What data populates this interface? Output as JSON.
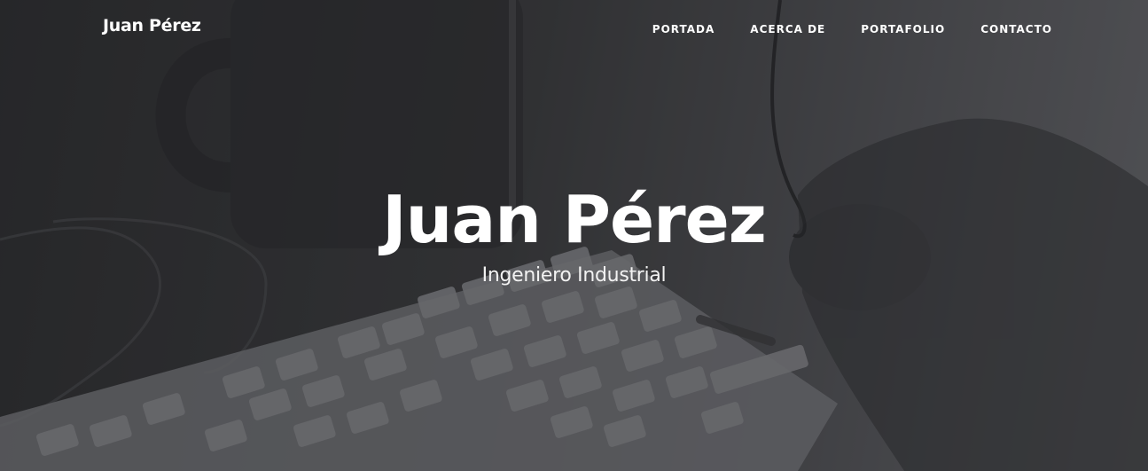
{
  "navbar": {
    "brand": "Juan Pérez",
    "links": [
      {
        "label": "PORTADA"
      },
      {
        "label": "ACERCA DE"
      },
      {
        "label": "PORTAFOLIO"
      },
      {
        "label": "CONTACTO"
      }
    ]
  },
  "hero": {
    "title": "Juan Pérez",
    "subtitle": "Ingeniero Industrial"
  }
}
